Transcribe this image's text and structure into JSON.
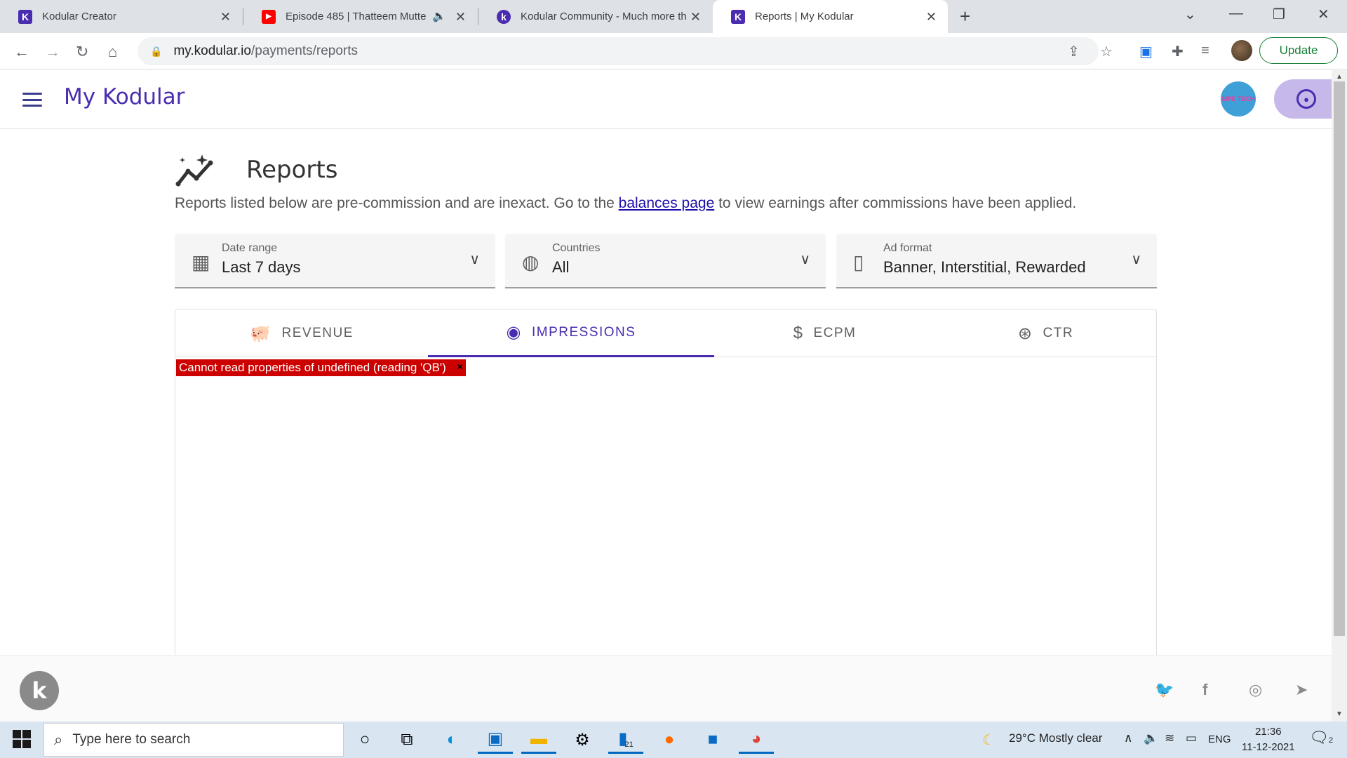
{
  "browser": {
    "tabs": [
      {
        "title": "Kodular Creator",
        "favicon": "K",
        "color": "#4a2cb0"
      },
      {
        "title": "Episode 485 | Thatteem Mutte",
        "favicon": "▶",
        "color": "#ff0000"
      },
      {
        "title": "Kodular Community - Much more th",
        "favicon": "k",
        "color": "#4a2cb0"
      },
      {
        "title": "Reports | My Kodular",
        "favicon": "K",
        "color": "#4a2cb0"
      }
    ],
    "url_domain": "my.kodular.io",
    "url_path": "/payments/reports",
    "update_label": "Update"
  },
  "app": {
    "brand": "My Kodular",
    "avatar_text": "MPE TECH"
  },
  "page": {
    "title": "Reports",
    "desc_before": "Reports listed below are pre-commission and are inexact. Go to the ",
    "desc_link": "balances page",
    "desc_after": " to view earnings after commissions have been applied."
  },
  "filters": [
    {
      "label": "Date range",
      "value": "Last 7 days",
      "icon": "calendar-icon"
    },
    {
      "label": "Countries",
      "value": "All",
      "icon": "globe-icon"
    },
    {
      "label": "Ad format",
      "value": "Banner, Interstitial, Rewarded",
      "icon": "phone-icon"
    }
  ],
  "report_tabs": [
    {
      "label": "REVENUE",
      "icon": "piggy-bank-icon"
    },
    {
      "label": "IMPRESSIONS",
      "icon": "eye-icon"
    },
    {
      "label": "ECPM",
      "icon": "dollar-icon"
    },
    {
      "label": "CTR",
      "icon": "cursor-click-icon"
    }
  ],
  "active_tab": "IMPRESSIONS",
  "error_message": "Cannot read properties of undefined (reading 'QB')",
  "error_close": "×",
  "footer": {
    "logo": "k",
    "social": [
      "twitter-icon",
      "facebook-icon",
      "instagram-icon",
      "telegram-icon"
    ]
  },
  "taskbar": {
    "search_placeholder": "Type here to search",
    "weather": "29°C  Mostly clear",
    "lang": "ENG",
    "time": "21:36",
    "date": "11-12-2021",
    "badge_count": "21",
    "notif_count": "2"
  }
}
